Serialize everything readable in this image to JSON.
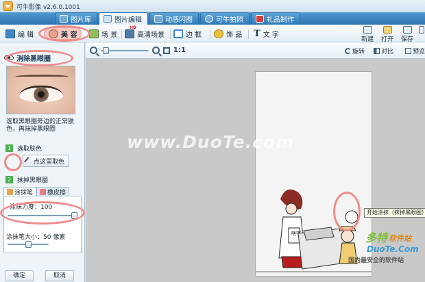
{
  "window": {
    "title": "可牛影像 v2.6.0.1001"
  },
  "top_tabs": [
    {
      "label": "图片库"
    },
    {
      "label": "图片编辑"
    },
    {
      "label": "动感闪图"
    },
    {
      "label": "可牛拍照"
    },
    {
      "label": "礼品制作"
    }
  ],
  "toolbar": {
    "tools": [
      "编 辑",
      "美 容",
      "场 景",
      "高清场景",
      "边 框",
      "饰 品",
      "文 字"
    ],
    "hd_badge": "HD",
    "text_glyph": "T",
    "right": [
      "新建",
      "打开",
      "保存"
    ]
  },
  "left_panel": {
    "title": "消除黑眼圈",
    "description": "选取黑眼圈旁边的正常肤色，再抹掉黑眼圈",
    "step1": {
      "num": "1",
      "label": "选取肤色",
      "button": "点这里取色"
    },
    "step2": {
      "num": "2",
      "label": "抹掉黑眼圈"
    },
    "subtabs": [
      "涂抹笔",
      "橡皮擦"
    ],
    "strength_label": "涂抹力度：100",
    "strength_value": 100,
    "brush_label": "涂抹笔大小：50 像素",
    "brush_value": 50,
    "ok": "确定",
    "cancel": "取消"
  },
  "zoom_bar": {
    "ratio": "1:1",
    "zoom_level": 0.05,
    "rotate": "旋转",
    "compare": "对比",
    "preview": "预览"
  },
  "canvas": {
    "sign_text": "啥字",
    "tooltip": "开始涂抹（抹掉黑眼圈）"
  },
  "watermarks": {
    "site": "www.DuoTe.com",
    "brand_a": "多特",
    "brand_b": "软件站",
    "brand_site": "DuoTe.Com",
    "slogan": "国内最安全的软件站"
  },
  "colors": {
    "accent_blue": "#2f79b6",
    "annotation": "#f08b8b",
    "step_green": "#4caf50"
  }
}
